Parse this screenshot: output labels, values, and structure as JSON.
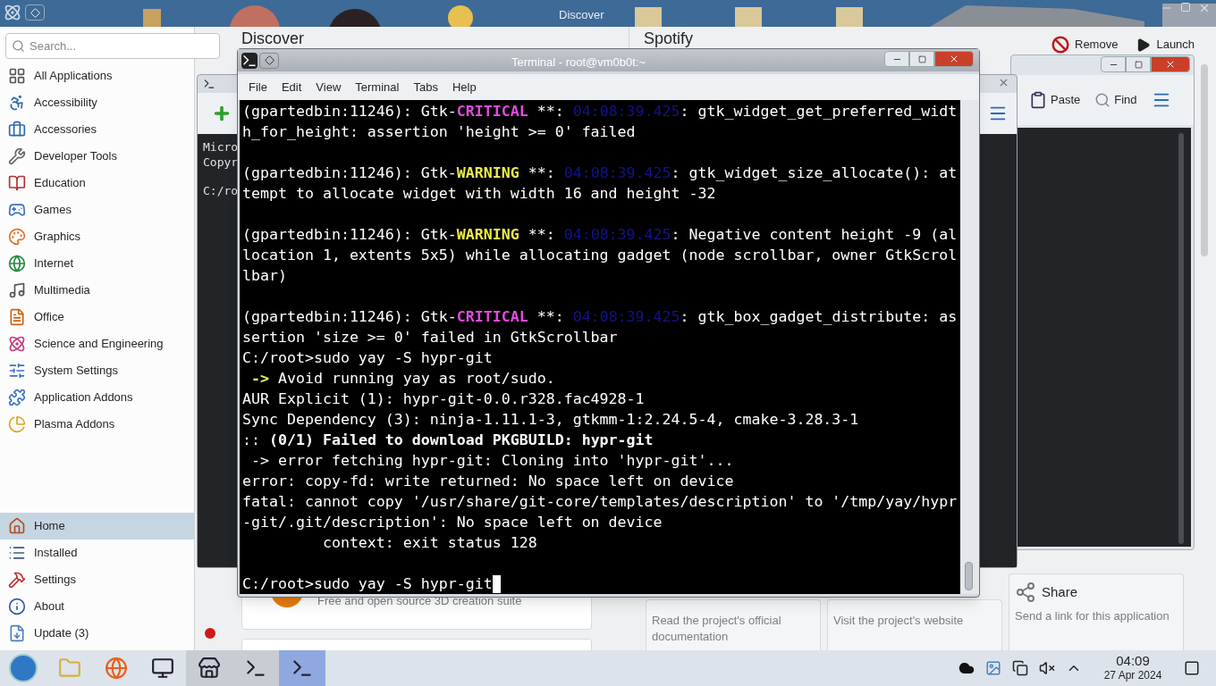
{
  "discover": {
    "title": "Discover",
    "search": {
      "placeholder": "Search..."
    },
    "categories": [
      "All Applications",
      "Accessibility",
      "Accessories",
      "Developer Tools",
      "Education",
      "Games",
      "Graphics",
      "Internet",
      "Multimedia",
      "Office",
      "Science and Engineering",
      "System Settings",
      "Application Addons",
      "Plasma Addons"
    ],
    "nav": [
      {
        "label": "Home",
        "selected": true,
        "alert": false
      },
      {
        "label": "Installed",
        "selected": false,
        "alert": false
      },
      {
        "label": "Settings",
        "selected": false,
        "alert": false
      },
      {
        "label": "About",
        "selected": false,
        "alert": false
      },
      {
        "label": "Update (3)",
        "selected": false,
        "alert": true
      }
    ],
    "page_heading": "Discover",
    "app_heading": "Spotify",
    "actions": [
      "Remove",
      "Launch"
    ],
    "featured_card": {
      "description": "Free and open source 3D creation suite"
    },
    "link_cards": [
      {
        "description": "Read the project's official documentation"
      },
      {
        "description": "Visit the project's website"
      },
      {
        "title": "Share",
        "description": "Send a link for this application"
      }
    ]
  },
  "file_window": {
    "toolbar": [
      "Paste",
      "Find"
    ]
  },
  "console_window": {
    "lines": [
      {
        "text": "Micro"
      },
      {
        "text": "Copyr"
      },
      {
        "kind": "blank"
      },
      {
        "text": "C:/ro"
      }
    ]
  },
  "terminal": {
    "title": "Terminal - root@vm0b0t:~",
    "menu": [
      "File",
      "Edit",
      "View",
      "Terminal",
      "Tabs",
      "Help"
    ],
    "lines": [
      {
        "segments": [
          {
            "kind": "plain",
            "text": "(gpartedbin:11246): Gtk-"
          },
          {
            "kind": "critical",
            "text": "CRITICAL"
          },
          {
            "kind": "plain",
            "text": " **: "
          },
          {
            "kind": "timestamp",
            "text": "04:08:39.425"
          },
          {
            "kind": "plain",
            "text": ": gtk_widget_get_preferred_widt"
          }
        ]
      },
      {
        "segments": [
          {
            "kind": "plain",
            "text": "h_for_height: assertion 'height >= 0' failed"
          }
        ]
      },
      {
        "kind": "blank"
      },
      {
        "segments": [
          {
            "kind": "plain",
            "text": "(gpartedbin:11246): Gtk-"
          },
          {
            "kind": "warning",
            "text": "WARNING"
          },
          {
            "kind": "plain",
            "text": " **: "
          },
          {
            "kind": "timestamp",
            "text": "04:08:39.425"
          },
          {
            "kind": "plain",
            "text": ": gtk_widget_size_allocate(): at"
          }
        ]
      },
      {
        "segments": [
          {
            "kind": "plain",
            "text": "tempt to allocate widget with width 16 and height -32"
          }
        ]
      },
      {
        "kind": "blank"
      },
      {
        "segments": [
          {
            "kind": "plain",
            "text": "(gpartedbin:11246): Gtk-"
          },
          {
            "kind": "warning",
            "text": "WARNING"
          },
          {
            "kind": "plain",
            "text": " **: "
          },
          {
            "kind": "timestamp",
            "text": "04:08:39.425"
          },
          {
            "kind": "plain",
            "text": ": Negative content height -9 (al"
          }
        ]
      },
      {
        "segments": [
          {
            "kind": "plain",
            "text": "location 1, extents 5x5) while allocating gadget (node scrollbar, owner GtkScrol"
          }
        ]
      },
      {
        "segments": [
          {
            "kind": "plain",
            "text": "lbar)"
          }
        ]
      },
      {
        "kind": "blank"
      },
      {
        "segments": [
          {
            "kind": "plain",
            "text": "(gpartedbin:11246): Gtk-"
          },
          {
            "kind": "critical",
            "text": "CRITICAL"
          },
          {
            "kind": "plain",
            "text": " **: "
          },
          {
            "kind": "timestamp",
            "text": "04:08:39.425"
          },
          {
            "kind": "plain",
            "text": ": gtk_box_gadget_distribute: as"
          }
        ]
      },
      {
        "segments": [
          {
            "kind": "plain",
            "text": "sertion 'size >= 0' failed in GtkScrollbar"
          }
        ]
      },
      {
        "segments": [
          {
            "kind": "plain",
            "text": "C:/root>sudo yay -S hypr-git"
          }
        ]
      },
      {
        "segments": [
          {
            "kind": "arrow",
            "text": " ->"
          },
          {
            "kind": "plain",
            "text": " Avoid running yay as root/sudo."
          }
        ]
      },
      {
        "segments": [
          {
            "kind": "plain",
            "text": "AUR Explicit (1): hypr-git-0.0.r328.fac4928-1"
          }
        ]
      },
      {
        "segments": [
          {
            "kind": "plain",
            "text": "Sync Dependency (3): ninja-1.11.1-3, gtkmm-1:2.24.5-4, cmake-3.28.3-1"
          }
        ]
      },
      {
        "segments": [
          {
            "kind": "plain",
            "text": ":: "
          },
          {
            "kind": "bold",
            "text": "(0/1) Failed to download PKGBUILD: hypr-git"
          }
        ]
      },
      {
        "segments": [
          {
            "kind": "plain",
            "text": " -> error fetching hypr-git: Cloning into 'hypr-git'..."
          }
        ]
      },
      {
        "segments": [
          {
            "kind": "plain",
            "text": "error: copy-fd: write returned: No space left on device"
          }
        ]
      },
      {
        "segments": [
          {
            "kind": "plain",
            "text": "fatal: cannot copy '/usr/share/git-core/templates/description' to '/tmp/yay/hypr"
          }
        ]
      },
      {
        "segments": [
          {
            "kind": "plain",
            "text": "-git/.git/description': No space left on device"
          }
        ]
      },
      {
        "segments": [
          {
            "kind": "plain",
            "text": "         context: exit status 128"
          }
        ]
      },
      {
        "kind": "blank"
      },
      {
        "cursor": true,
        "segments": [
          {
            "kind": "plain",
            "text": "C:/root>sudo yay -S hypr-git"
          }
        ]
      }
    ]
  },
  "taskbar": {
    "tasks": [
      {
        "kind": "start",
        "running": false,
        "selected": false
      },
      {
        "kind": "files",
        "running": false,
        "selected": false
      },
      {
        "kind": "browser",
        "running": false,
        "selected": false
      },
      {
        "kind": "system",
        "running": false,
        "selected": false
      },
      {
        "kind": "store",
        "running": true,
        "selected": false
      },
      {
        "kind": "console",
        "running": true,
        "selected": false
      },
      {
        "kind": "terminal",
        "running": true,
        "selected": true
      }
    ],
    "clock": {
      "time": "04:09",
      "date": "27 Apr 2024"
    }
  }
}
